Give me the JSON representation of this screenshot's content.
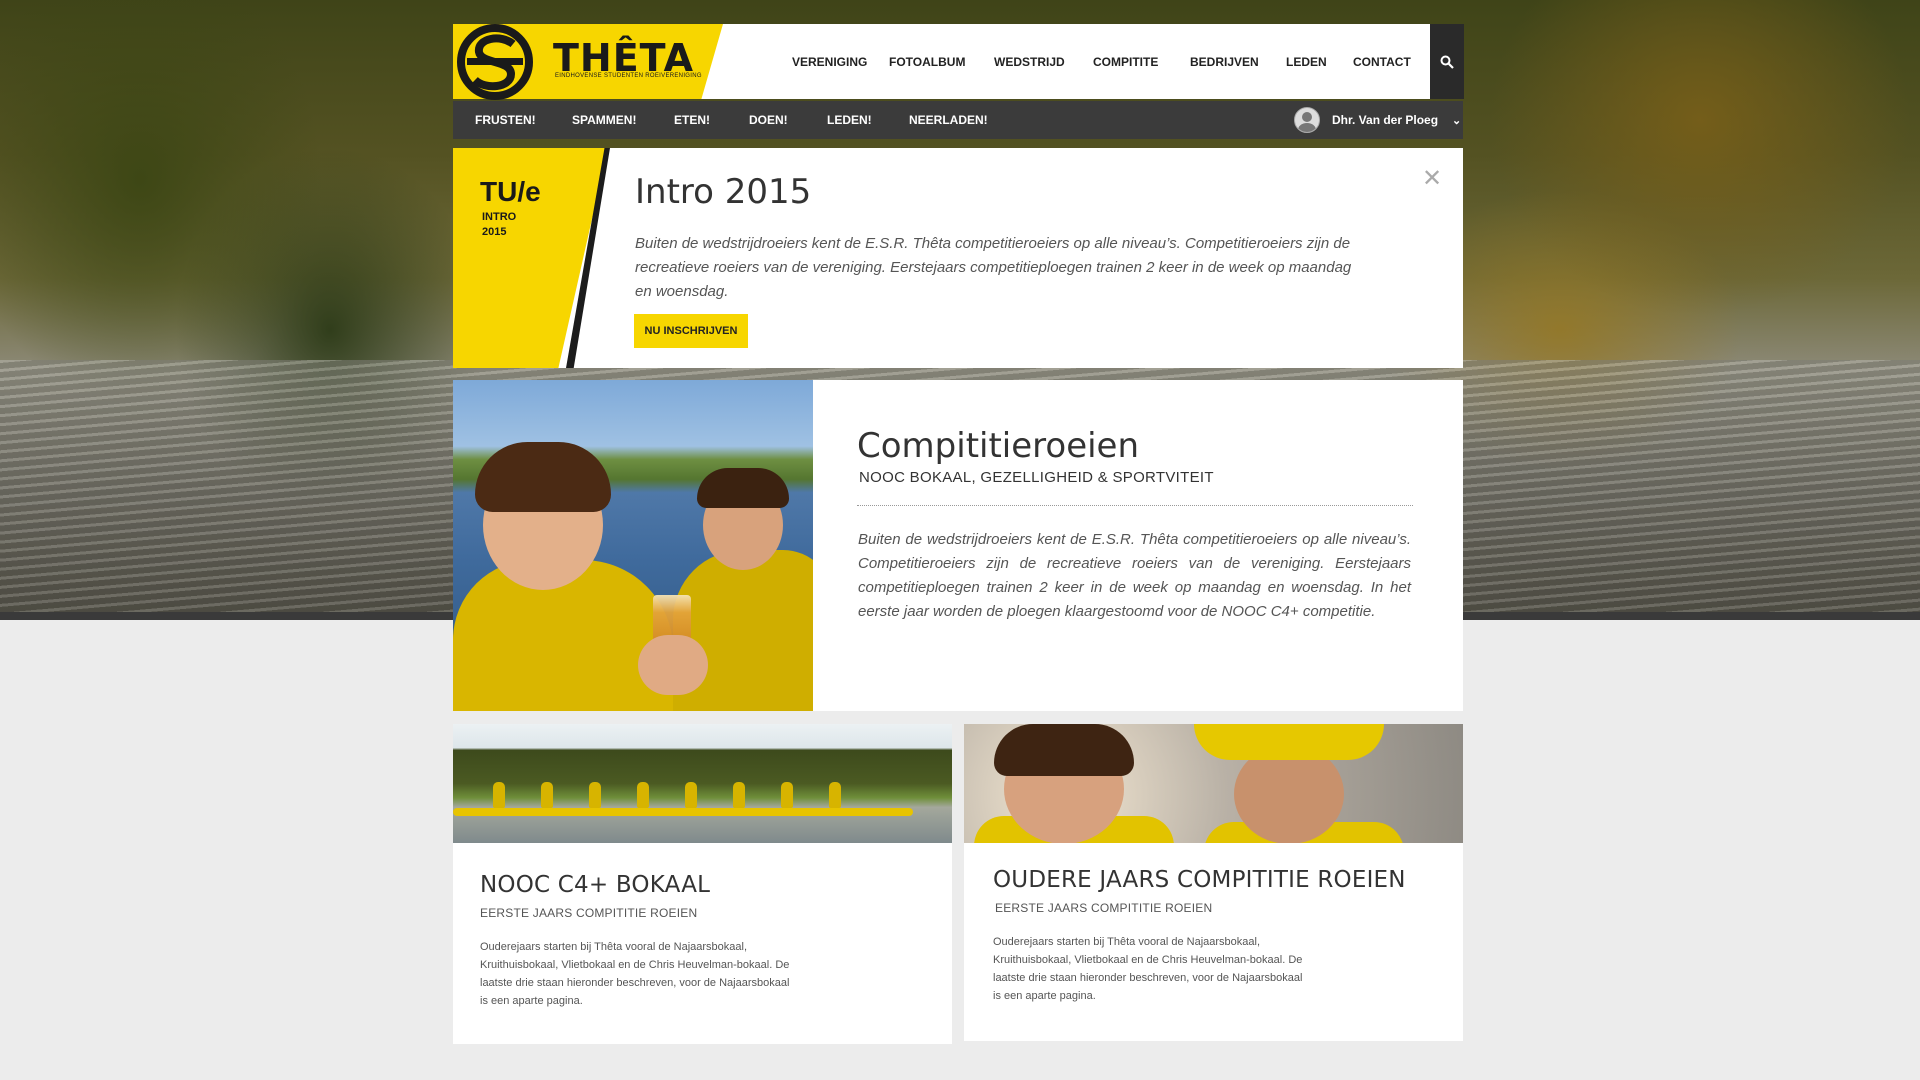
{
  "brand": {
    "name": "THÊTA",
    "tagline": "EINDHOVENSE STUDENTEN ROEIVERENIGING",
    "accent": "#f7d600",
    "dark": "#3b3b3b"
  },
  "main_nav": [
    "VERENIGING",
    "FOTOALBUM",
    "WEDSTRIJD",
    "COMPITITE",
    "BEDRIJVEN",
    "LEDEN",
    "CONTACT"
  ],
  "sub_nav": [
    "FRUSTEN!",
    "SPAMMEN!",
    "ETEN!",
    "DOEN!",
    "LEDEN!",
    "NEERLADEN!"
  ],
  "user": {
    "name": "Dhr. Van der Ploeg"
  },
  "icons": {
    "search": "search-icon",
    "chevron": "chevron-down-icon",
    "close": "close-icon"
  },
  "intro": {
    "badge_logo": "TU/e",
    "badge_line1": "INTRO",
    "badge_line2": "2015",
    "title": "Intro 2015",
    "text": "Buiten de wedstrijdroeiers kent de E.S.R. Thêta competitieroeiers op alle niveau’s. Competitieroeiers zijn de recreatieve roeiers van de vereniging. Eerstejaars competitieploegen trainen 2 keer in de week op maandag en woensdag.",
    "button": "NU INSCHRIJVEN"
  },
  "feature": {
    "title": "Compititieroeien",
    "subtitle": "NOOC BOKAAL, GEZELLIGHEID & SPORTVITEIT",
    "text": "Buiten de wedstrijdroeiers kent de E.S.R. Thêta competitieroeiers op alle niveau’s. Competitieroeiers zijn de recreatieve roeiers van de vereniging. Eerstejaars competitieploegen trainen 2 keer in de week op maandag en woensdag. In het eerste jaar worden de ploegen klaargestoomd voor de NOOC C4+ competitie."
  },
  "cards": [
    {
      "title": "NOOC C4+ BOKAAL",
      "subtitle": "EERSTE JAARS COMPITITIE ROEIEN",
      "text": "Ouderejaars starten bij Thêta vooral de Najaarsbokaal, Kruithuisbokaal, Vlietbokaal en de Chris Heuvelman-bokaal. De laatste drie staan hieronder beschreven, voor de Najaarsbokaal is een aparte pagina."
    },
    {
      "title": "OUDERE JAARS COMPITITIE ROEIEN",
      "subtitle": "EERSTE JAARS COMPITITIE ROEIEN",
      "text": "Ouderejaars starten bij Thêta vooral de Najaarsbokaal, Kruithuisbokaal, Vlietbokaal en de Chris Heuvelman-bokaal. De laatste drie staan hieronder beschreven, voor de Najaarsbokaal is een aparte pagina."
    }
  ]
}
